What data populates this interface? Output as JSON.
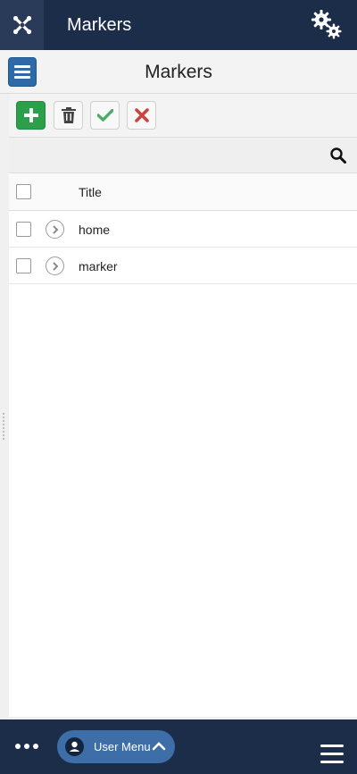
{
  "app": {
    "title": "Markers"
  },
  "header": {
    "title": "Markers"
  },
  "toolbar": {
    "buttons": [
      {
        "icon": "plus-icon",
        "color": "#2b9f4a"
      },
      {
        "icon": "trash-icon"
      },
      {
        "icon": "check-icon",
        "color": "#4cae6a"
      },
      {
        "icon": "x-icon",
        "color": "#c9463d"
      }
    ]
  },
  "table": {
    "columns": {
      "title": "Title"
    },
    "rows": [
      {
        "title": "home"
      },
      {
        "title": "marker"
      }
    ]
  },
  "footer": {
    "user_menu_label": "User Menu"
  },
  "colors": {
    "topbar": "#1c2d4a",
    "accent": "#2f6aa8",
    "user_menu": "#3d6ea8"
  }
}
